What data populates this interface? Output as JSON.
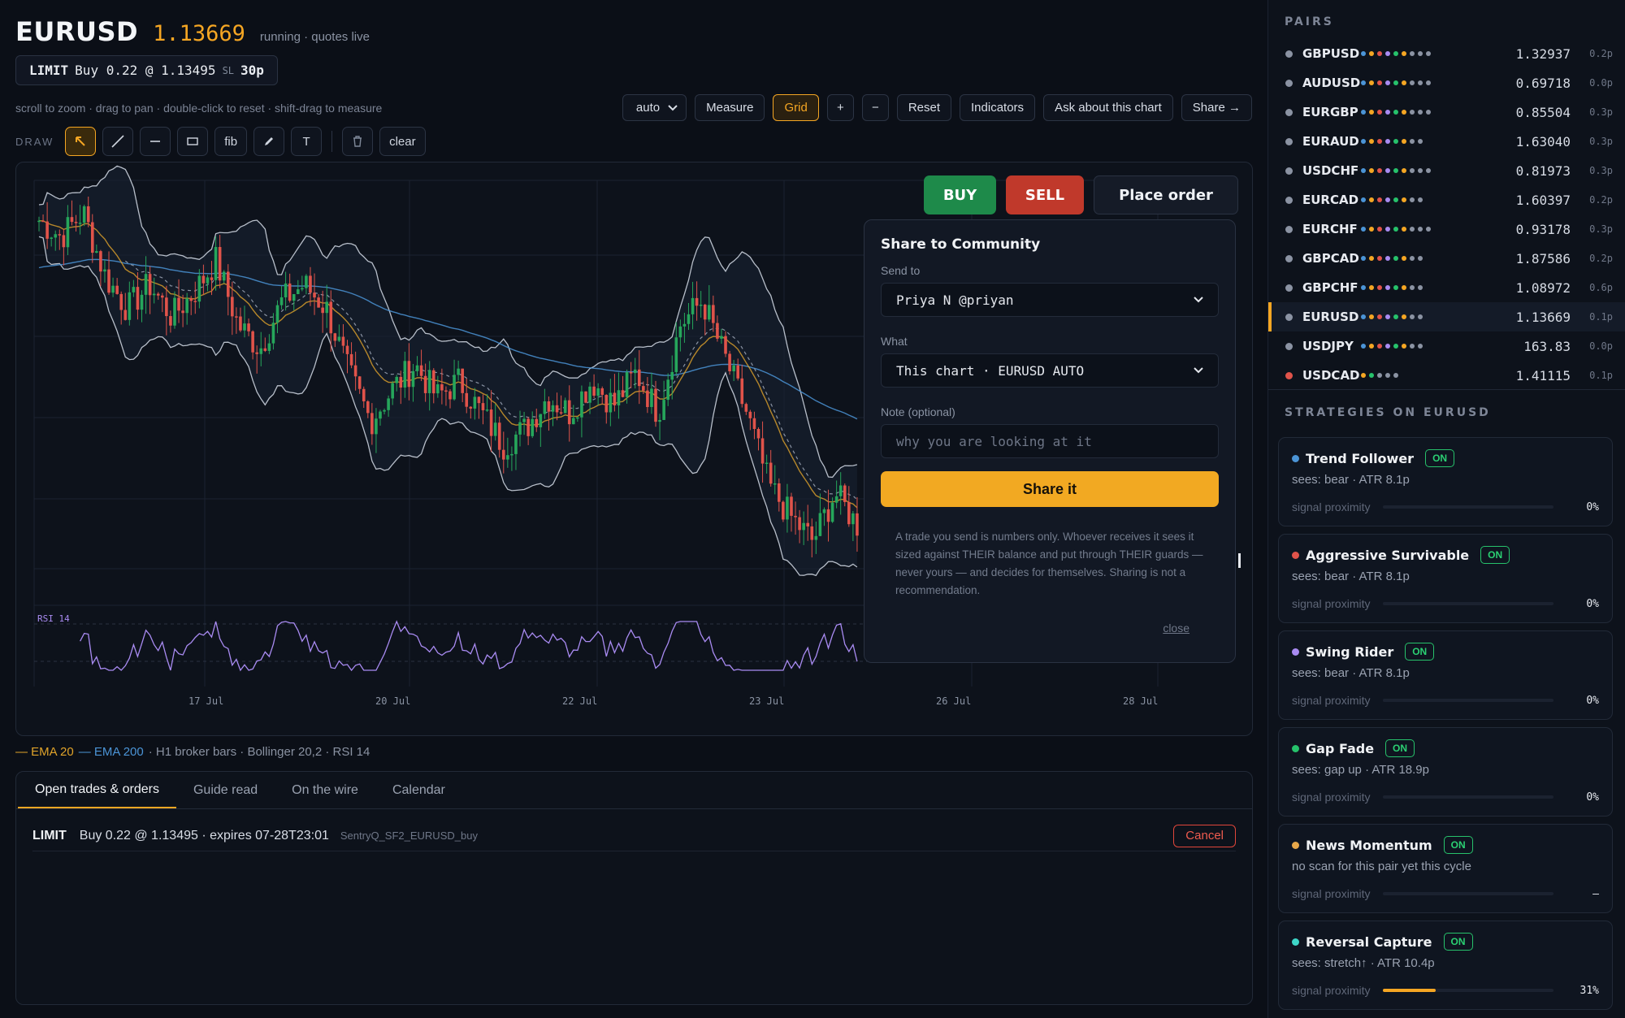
{
  "header": {
    "symbol": "EURUSD",
    "price": "1.13669",
    "status": "running · quotes live"
  },
  "pending_order": {
    "type": "LIMIT",
    "text": "Buy 0.22 @ 1.13495",
    "sl_label": "SL",
    "sl_value": "30p"
  },
  "hint": "scroll to zoom · drag to pan · double-click to reset · shift-drag to measure",
  "toolbar": {
    "interval": "auto",
    "measure": "Measure",
    "grid": "Grid",
    "zoom_in": "+",
    "zoom_out": "−",
    "reset": "Reset",
    "indicators": "Indicators",
    "ask": "Ask about this chart",
    "share": "Share →"
  },
  "draw": {
    "label": "DRAW",
    "fib": "fib",
    "text_tool": "T",
    "clear": "clear"
  },
  "trade": {
    "buy": "BUY",
    "sell": "SELL",
    "place": "Place order"
  },
  "share_popup": {
    "title": "Share to Community",
    "send_to_label": "Send to",
    "send_to_value": "Priya N @priyan",
    "what_label": "What",
    "what_value": "This chart · EURUSD AUTO",
    "note_label": "Note (optional)",
    "note_placeholder": "why you are looking at it",
    "submit": "Share it",
    "disclaimer": "A trade you send is numbers only. Whoever receives it sees it sized against THEIR balance and put through THEIR guards — never yours — and decides for themselves. Sharing is not a recommendation.",
    "close": "close"
  },
  "chart_data": {
    "type": "candlestick",
    "symbol": "EURUSD",
    "timeframe": "H1",
    "x_tick_labels": [
      "17 Jul",
      "20 Jul",
      "22 Jul",
      "23 Jul",
      "26 Jul",
      "28 Jul"
    ],
    "close_path": [
      1.155,
      1.153,
      1.156,
      1.148,
      1.144,
      1.147,
      1.143,
      1.146,
      1.15,
      1.142,
      1.139,
      1.145,
      1.147,
      1.144,
      1.136,
      1.13,
      1.134,
      1.137,
      1.133,
      1.135,
      1.131,
      1.127,
      1.129,
      1.133,
      1.131,
      1.135,
      1.132,
      1.136,
      1.131,
      1.142,
      1.145,
      1.138,
      1.131,
      1.122,
      1.118,
      1.115,
      1.121,
      1.117
    ],
    "indicators": {
      "ema20": {
        "label": "EMA 20",
        "color": "#e0a32a"
      },
      "ema200": {
        "label": "EMA 200",
        "color": "#4b94d6"
      },
      "bollinger": {
        "label": "Bollinger 20,2"
      },
      "rsi": {
        "label": "RSI 14",
        "color": "#a98bf2"
      }
    },
    "colors": {
      "up": "#26a65b",
      "down": "#e0534a",
      "bg": "#0d121b",
      "grid": "#1c2330"
    }
  },
  "legend": {
    "ema20": "— EMA 20",
    "ema200": "— EMA 200",
    "rest": "· H1 broker bars · Bollinger 20,2 · RSI 14"
  },
  "bottom": {
    "tabs": [
      "Open trades & orders",
      "Guide read",
      "On the wire",
      "Calendar"
    ],
    "order": {
      "type": "LIMIT",
      "text": "Buy 0.22 @ 1.13495 · expires 07-28T23:01",
      "ref": "SentryQ_SF2_EURUSD_buy",
      "cancel": "Cancel"
    }
  },
  "sidebar": {
    "pairs_title": "PAIRS",
    "pairs": [
      {
        "name": "GBPUSD",
        "price": "1.32937",
        "spread": "0.2p",
        "color": "#8b93a3",
        "strip": [
          "#4b94d6",
          "#f5a623",
          "#e0534a",
          "#a98bf2",
          "#26c26b",
          "#f5a623",
          "#8b93a3",
          "#8b93a3",
          "#8b93a3"
        ]
      },
      {
        "name": "AUDUSD",
        "price": "0.69718",
        "spread": "0.0p",
        "color": "#8b93a3",
        "strip": [
          "#4b94d6",
          "#f5a623",
          "#e0534a",
          "#a98bf2",
          "#26c26b",
          "#f5a623",
          "#8b93a3",
          "#8b93a3",
          "#8b93a3"
        ]
      },
      {
        "name": "EURGBP",
        "price": "0.85504",
        "spread": "0.3p",
        "color": "#8b93a3",
        "strip": [
          "#4b94d6",
          "#f5a623",
          "#e0534a",
          "#a98bf2",
          "#26c26b",
          "#f5a623",
          "#8b93a3",
          "#8b93a3",
          "#8b93a3"
        ]
      },
      {
        "name": "EURAUD",
        "price": "1.63040",
        "spread": "0.3p",
        "color": "#8b93a3",
        "strip": [
          "#4b94d6",
          "#f5a623",
          "#e0534a",
          "#a98bf2",
          "#26c26b",
          "#f5a623",
          "#8b93a3",
          "#8b93a3"
        ]
      },
      {
        "name": "USDCHF",
        "price": "0.81973",
        "spread": "0.3p",
        "color": "#8b93a3",
        "strip": [
          "#4b94d6",
          "#f5a623",
          "#e0534a",
          "#a98bf2",
          "#26c26b",
          "#f5a623",
          "#8b93a3",
          "#8b93a3",
          "#8b93a3"
        ]
      },
      {
        "name": "EURCAD",
        "price": "1.60397",
        "spread": "0.2p",
        "color": "#8b93a3",
        "strip": [
          "#4b94d6",
          "#f5a623",
          "#e0534a",
          "#a98bf2",
          "#26c26b",
          "#f5a623",
          "#8b93a3",
          "#8b93a3"
        ]
      },
      {
        "name": "EURCHF",
        "price": "0.93178",
        "spread": "0.3p",
        "color": "#8b93a3",
        "strip": [
          "#4b94d6",
          "#f5a623",
          "#e0534a",
          "#a98bf2",
          "#26c26b",
          "#f5a623",
          "#8b93a3",
          "#8b93a3",
          "#8b93a3"
        ]
      },
      {
        "name": "GBPCAD",
        "price": "1.87586",
        "spread": "0.2p",
        "color": "#8b93a3",
        "strip": [
          "#4b94d6",
          "#f5a623",
          "#e0534a",
          "#a98bf2",
          "#26c26b",
          "#f5a623",
          "#8b93a3",
          "#8b93a3"
        ]
      },
      {
        "name": "GBPCHF",
        "price": "1.08972",
        "spread": "0.6p",
        "color": "#8b93a3",
        "strip": [
          "#4b94d6",
          "#f5a623",
          "#e0534a",
          "#a98bf2",
          "#26c26b",
          "#f5a623",
          "#8b93a3",
          "#8b93a3"
        ]
      },
      {
        "name": "EURUSD",
        "price": "1.13669",
        "spread": "0.1p",
        "color": "#8b93a3",
        "strip": [
          "#4b94d6",
          "#f5a623",
          "#e0534a",
          "#a98bf2",
          "#26c26b",
          "#f5a623",
          "#8b93a3",
          "#8b93a3"
        ],
        "selected": true
      },
      {
        "name": "USDJPY",
        "price": "163.83",
        "spread": "0.0p",
        "color": "#8b93a3",
        "strip": [
          "#4b94d6",
          "#f5a623",
          "#e0534a",
          "#a98bf2",
          "#26c26b",
          "#f5a623",
          "#8b93a3",
          "#8b93a3"
        ]
      },
      {
        "name": "USDCAD",
        "price": "1.41115",
        "spread": "0.1p",
        "color": "#e0534a",
        "strip": [
          "#f5a623",
          "#26c26b",
          "#8b93a3",
          "#8b93a3",
          "#8b93a3"
        ]
      }
    ],
    "strategies_title": "STRATEGIES ON EURUSD",
    "strategies": [
      {
        "name": "Trend Follower",
        "state": "ON",
        "color": "#4b94d6",
        "sees": "sees: bear · ATR 8.1p",
        "prox_label": "signal proximity",
        "proximity": 0,
        "pct": "0%"
      },
      {
        "name": "Aggressive Survivable",
        "state": "ON",
        "color": "#e0534a",
        "sees": "sees: bear · ATR 8.1p",
        "prox_label": "signal proximity",
        "proximity": 0,
        "pct": "0%"
      },
      {
        "name": "Swing Rider",
        "state": "ON",
        "color": "#a98bf2",
        "sees": "sees: bear · ATR 8.1p",
        "prox_label": "signal proximity",
        "proximity": 0,
        "pct": "0%"
      },
      {
        "name": "Gap Fade",
        "state": "ON",
        "color": "#26c26b",
        "sees": "sees: gap up · ATR 18.9p",
        "prox_label": "signal proximity",
        "proximity": 0,
        "pct": "0%"
      },
      {
        "name": "News Momentum",
        "state": "ON",
        "color": "#e8a84a",
        "sees": "no scan for this pair yet this cycle",
        "prox_label": "signal proximity",
        "proximity": 0,
        "pct": "–"
      },
      {
        "name": "Reversal Capture",
        "state": "ON",
        "color": "#3ed6c8",
        "sees": "sees: stretch↑ · ATR 10.4p",
        "prox_label": "signal proximity",
        "proximity": 0.31,
        "pct": "31%"
      }
    ]
  }
}
